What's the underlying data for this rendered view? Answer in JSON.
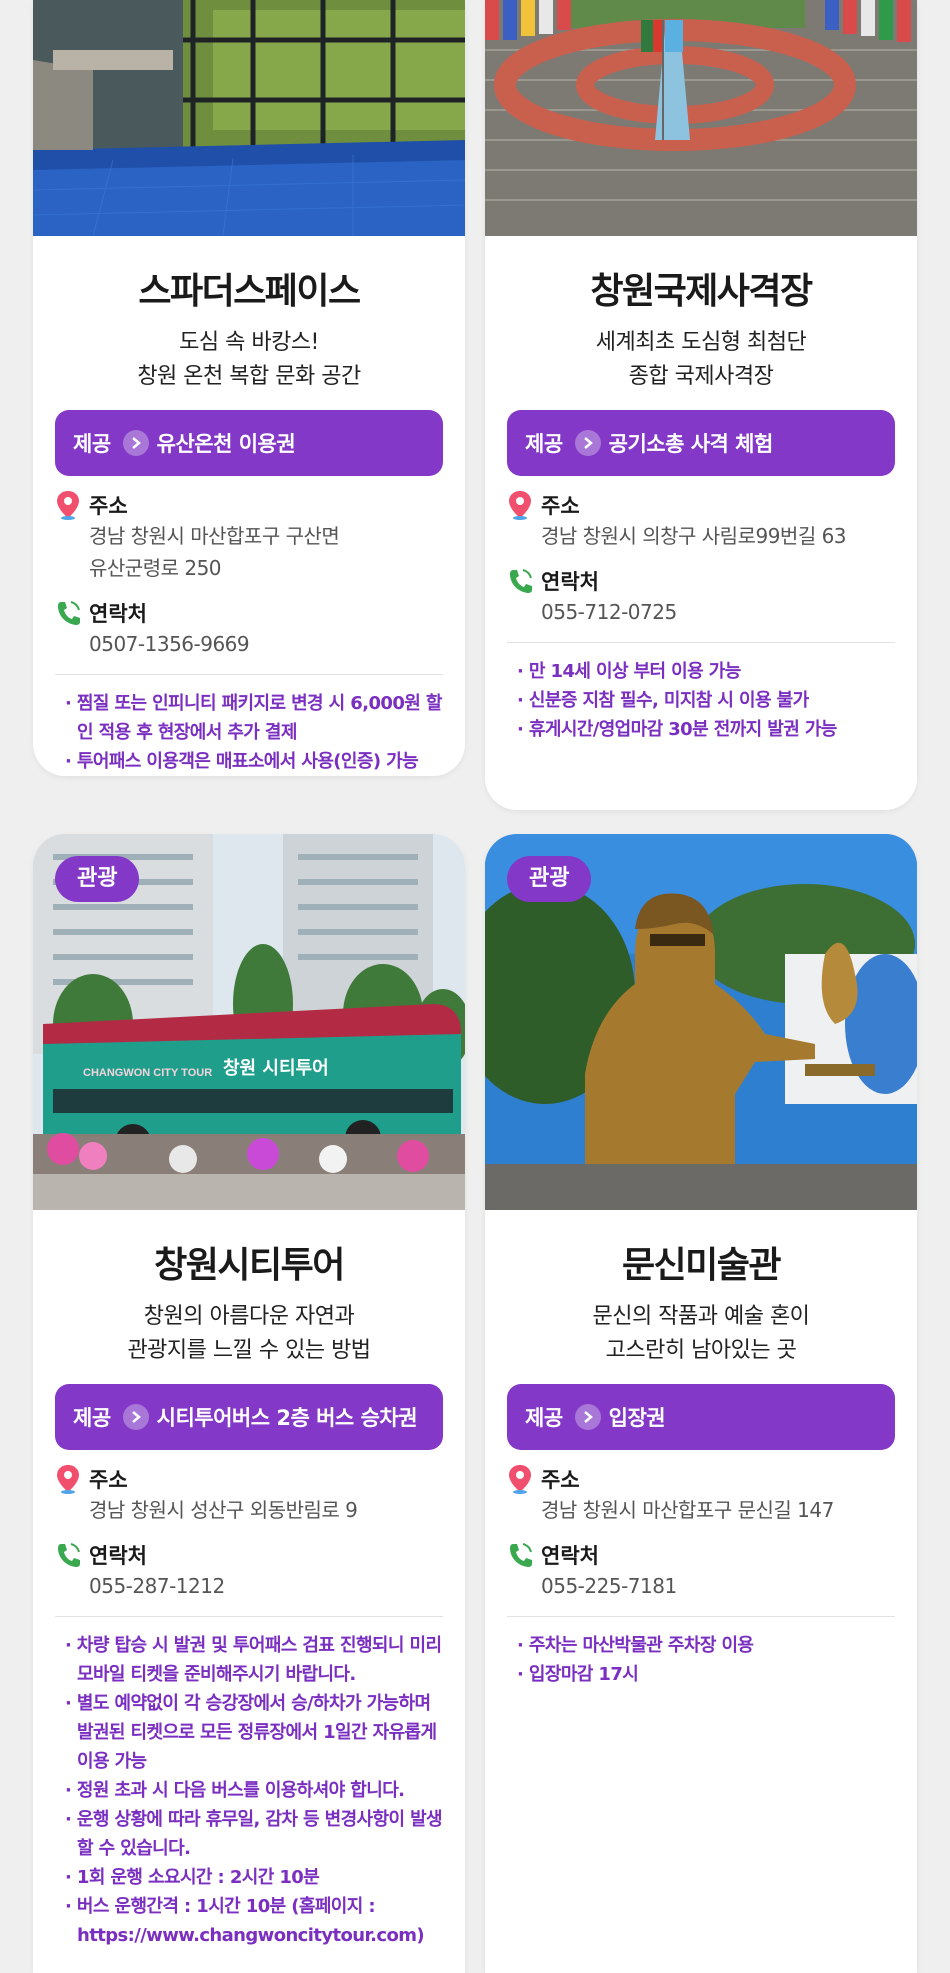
{
  "labels": {
    "offer_prefix": "제공",
    "address_label": "주소",
    "contact_label": "연락처"
  },
  "cards": [
    {
      "title": "스파더스페이스",
      "desc_lines": [
        "도심 속 바캉스!",
        "창원 온천 복합 문화 공간"
      ],
      "offer": "유산온천 이용권",
      "address_lines": [
        "경남 창원시 마산합포구 구산면",
        "유산군령로 250"
      ],
      "contact": "0507-1356-9669",
      "notes": [
        "찜질 또는 인피니티 패키지로 변경 시 6,000원 할인 적용 후 현장에서 추가 결제",
        "투어패스 이용객은 매표소에서 사용(인증) 가능"
      ]
    },
    {
      "title": "창원국제사격장",
      "desc_lines": [
        "세계최초 도심형 최첨단",
        "종합 국제사격장"
      ],
      "offer": "공기소총 사격 체험",
      "address_lines": [
        "경남 창원시 의창구 사림로99번길 63"
      ],
      "contact": "055-712-0725",
      "notes": [
        "만 14세 이상 부터 이용 가능",
        "신분증 지참 필수, 미지참 시 이용 불가",
        "휴게시간/영업마감 30분 전까지 발권 가능"
      ]
    },
    {
      "badge": "관광",
      "title": "창원시티투어",
      "desc_lines": [
        "창원의 아름다운 자연과",
        "관광지를 느낄 수 있는 방법"
      ],
      "offer": "시티투어버스 2층 버스 승차권",
      "address_lines": [
        "경남 창원시 성산구 외동반림로 9"
      ],
      "contact": "055-287-1212",
      "bus_text": "CHANGWON CITY TOUR",
      "bus_logo": "창원 시티투어",
      "notes": [
        "차량 탑승 시 발권 및 투어패스 검표 진행되니 미리 모바일 티켓을 준비해주시기 바랍니다.",
        "별도 예약없이 각 승강장에서 승/하차가 가능하며 발권된 티켓으로 모든 정류장에서 1일간 자유롭게 이용 가능",
        "정원 초과 시 다음 버스를 이용하셔야 합니다.",
        "운행 상황에 따라 휴무일, 감차 등 변경사항이 발생 할 수 있습니다.",
        "1회 운행 소요시간 : 2시간 10분",
        "버스 운행간격 : 1시간 10분 (홈페이지 : https://www.changwoncitytour.com)"
      ]
    },
    {
      "badge": "관광",
      "title": "문신미술관",
      "desc_lines": [
        "문신의 작품과 예술 혼이",
        "고스란히 남아있는 곳"
      ],
      "offer": "입장권",
      "address_lines": [
        "경남 창원시 마산합포구 문신길 147"
      ],
      "contact": "055-225-7181",
      "notes": [
        "주차는 마산박물관 주차장 이용",
        "입장마감 17시"
      ]
    }
  ]
}
